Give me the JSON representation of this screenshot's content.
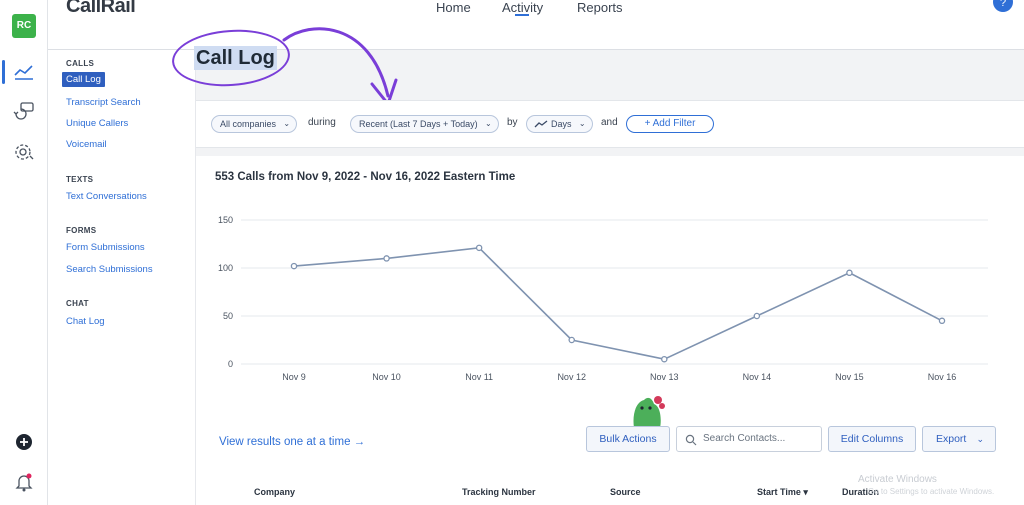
{
  "app": {
    "logo_text": "CallRail",
    "avatar_initials": "RC",
    "help_label": "?"
  },
  "topnav": {
    "items": [
      "Home",
      "Activity",
      "Reports"
    ],
    "active": "Activity"
  },
  "sidebar": {
    "sections": [
      {
        "heading": "CALLS",
        "items": [
          "Call Log",
          "Transcript Search",
          "Unique Callers",
          "Voicemail"
        ]
      },
      {
        "heading": "TEXTS",
        "items": [
          "Text Conversations"
        ]
      },
      {
        "heading": "FORMS",
        "items": [
          "Form Submissions",
          "Search Submissions"
        ]
      },
      {
        "heading": "CHAT",
        "items": [
          "Chat Log"
        ]
      }
    ],
    "active_item": "Call Log"
  },
  "page": {
    "title": "Call Log"
  },
  "filters": {
    "company": "All companies",
    "during_word": "during",
    "range": "Recent (Last 7 Days + Today)",
    "by_word": "by",
    "granularity": "Days",
    "and_word": "and",
    "add_filter": "+ Add Filter"
  },
  "chart_data": {
    "type": "line",
    "title": "553 Calls from Nov 9, 2022 - Nov 16, 2022 Eastern Time",
    "categories": [
      "Nov 9",
      "Nov 10",
      "Nov 11",
      "Nov 12",
      "Nov 13",
      "Nov 14",
      "Nov 15",
      "Nov 16"
    ],
    "values": [
      102,
      110,
      121,
      25,
      5,
      50,
      95,
      45
    ],
    "yticks": [
      0,
      50,
      100,
      150
    ],
    "ylim": [
      0,
      150
    ],
    "grid": true,
    "line_color": "#7f93b0"
  },
  "actions": {
    "view_link": "View results one at a time →",
    "bulk_actions": "Bulk Actions",
    "search_placeholder": "Search Contacts...",
    "edit_columns": "Edit Columns",
    "export": "Export"
  },
  "table": {
    "columns": [
      "Company",
      "Tracking Number",
      "Source",
      "Start Time ▾",
      "Duration"
    ]
  },
  "watermark": {
    "line1": "Activate Windows",
    "line2": "Go to Settings to activate Windows."
  },
  "colors": {
    "accent": "#2f6fd6",
    "annotation": "#7a3ed8",
    "avatar": "#3cb24a"
  }
}
